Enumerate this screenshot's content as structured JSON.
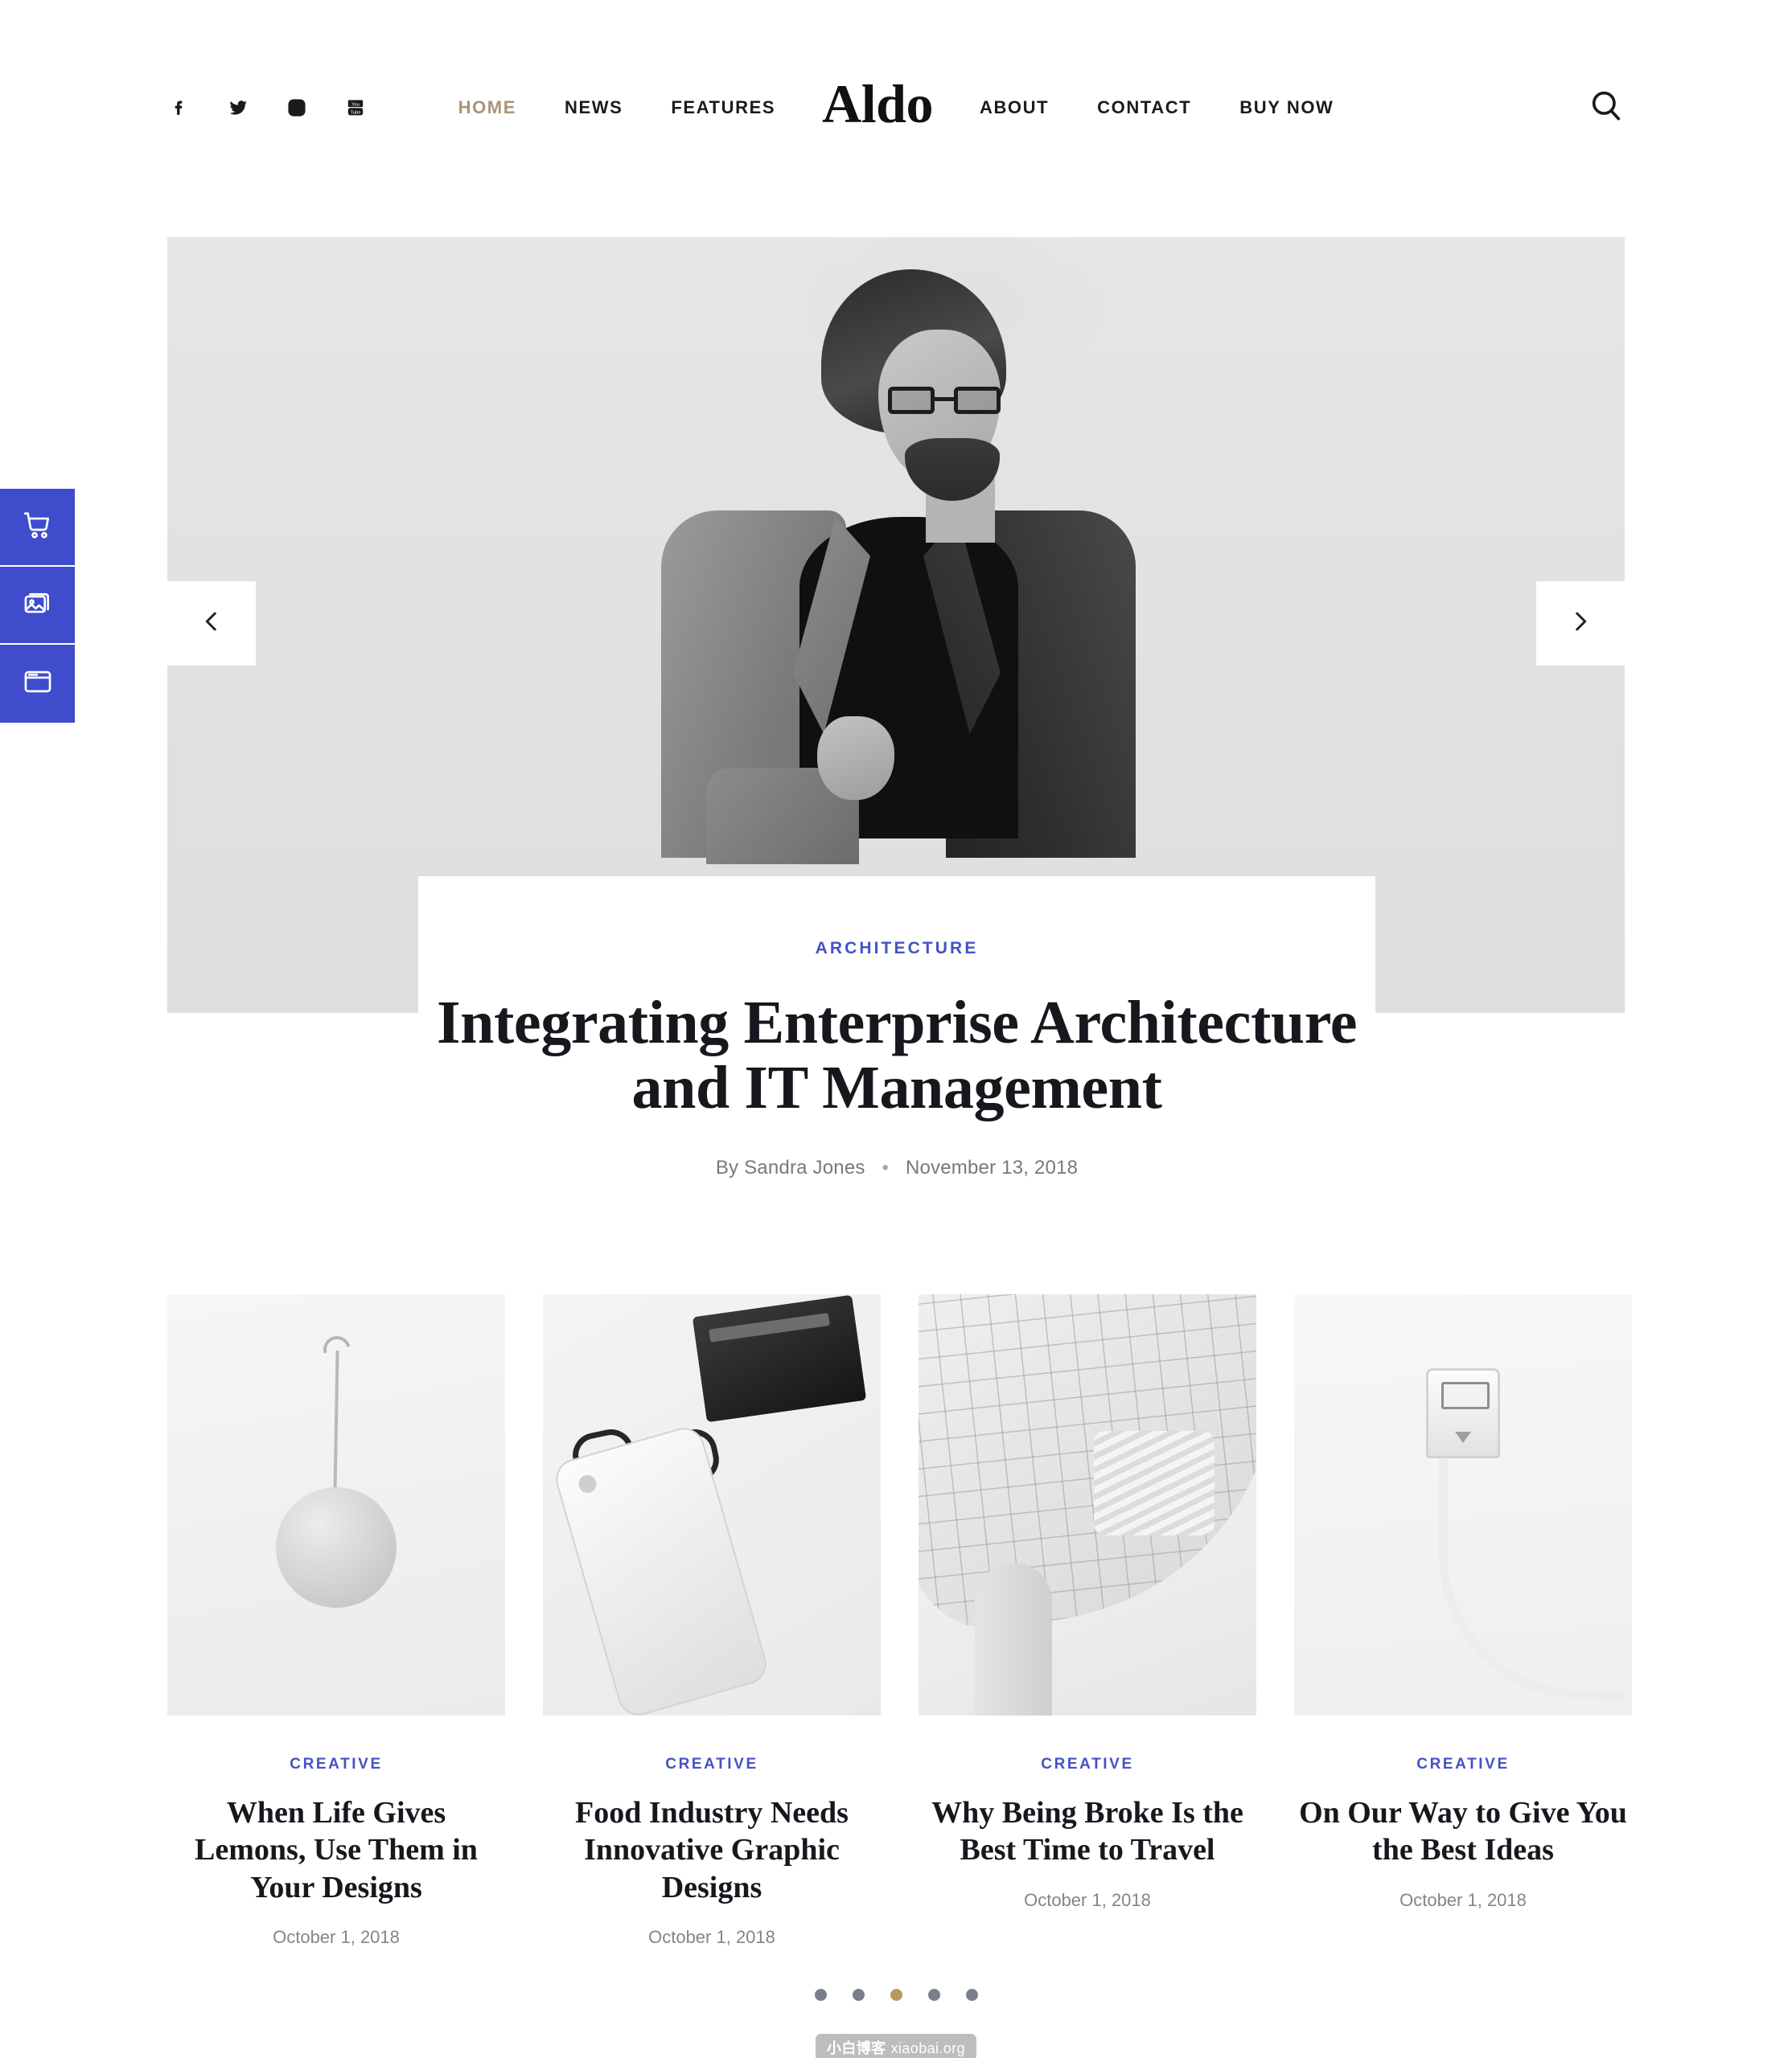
{
  "brand": {
    "name": "Aldo"
  },
  "social": [
    {
      "name": "facebook-icon",
      "label": "Facebook"
    },
    {
      "name": "twitter-icon",
      "label": "Twitter"
    },
    {
      "name": "instagram-icon",
      "label": "Instagram"
    },
    {
      "name": "youtube-icon",
      "label": "YouTube"
    }
  ],
  "nav": {
    "left": [
      {
        "label": "HOME",
        "active": true
      },
      {
        "label": "NEWS",
        "active": false
      },
      {
        "label": "FEATURES",
        "active": false
      }
    ],
    "right": [
      {
        "label": "ABOUT",
        "active": false
      },
      {
        "label": "CONTACT",
        "active": false
      },
      {
        "label": "BUY NOW",
        "active": false
      }
    ],
    "active_color": "#a89474",
    "search_label": "Search"
  },
  "sidebar": {
    "items": [
      {
        "icon": "shopping-cart-icon",
        "label": "Cart"
      },
      {
        "icon": "gallery-icon",
        "label": "Gallery"
      },
      {
        "icon": "browser-window-icon",
        "label": "Layouts"
      }
    ],
    "color": "#3f4ccc"
  },
  "hero": {
    "prev_label": "Previous slide",
    "next_label": "Next slide",
    "category": "ARCHITECTURE",
    "title": "Integrating Enterprise Architecture and IT Management",
    "author": "By Sandra Jones",
    "separator": "•",
    "date": "November 13, 2018",
    "category_color": "#4453c4"
  },
  "cards": [
    {
      "category": "CREATIVE",
      "title": "When Life Gives Lemons, Use Them in Your Designs",
      "date": "October 1, 2018",
      "image": "wall-mounted-speaker-photo"
    },
    {
      "category": "CREATIVE",
      "title": "Food Industry Needs Innovative Graphic Designs",
      "date": "October 1, 2018",
      "image": "desk-flatlay-phone-glasses-photo"
    },
    {
      "category": "CREATIVE",
      "title": "Why Being Broke Is the Best Time to Travel",
      "date": "October 1, 2018",
      "image": "curved-architecture-photo"
    },
    {
      "category": "CREATIVE",
      "title": "On Our Way to Give You the Best Ideas",
      "date": "October 1, 2018",
      "image": "usb-cable-photo"
    }
  ],
  "pagination": {
    "dots": [
      {
        "active": false
      },
      {
        "active": false
      },
      {
        "active": true
      },
      {
        "active": false
      },
      {
        "active": false
      }
    ],
    "active_color": "#b79a5c",
    "inactive_color": "#7a7f8c"
  },
  "watermark": {
    "cn": "小白博客",
    "site": "xiaobai.org"
  }
}
